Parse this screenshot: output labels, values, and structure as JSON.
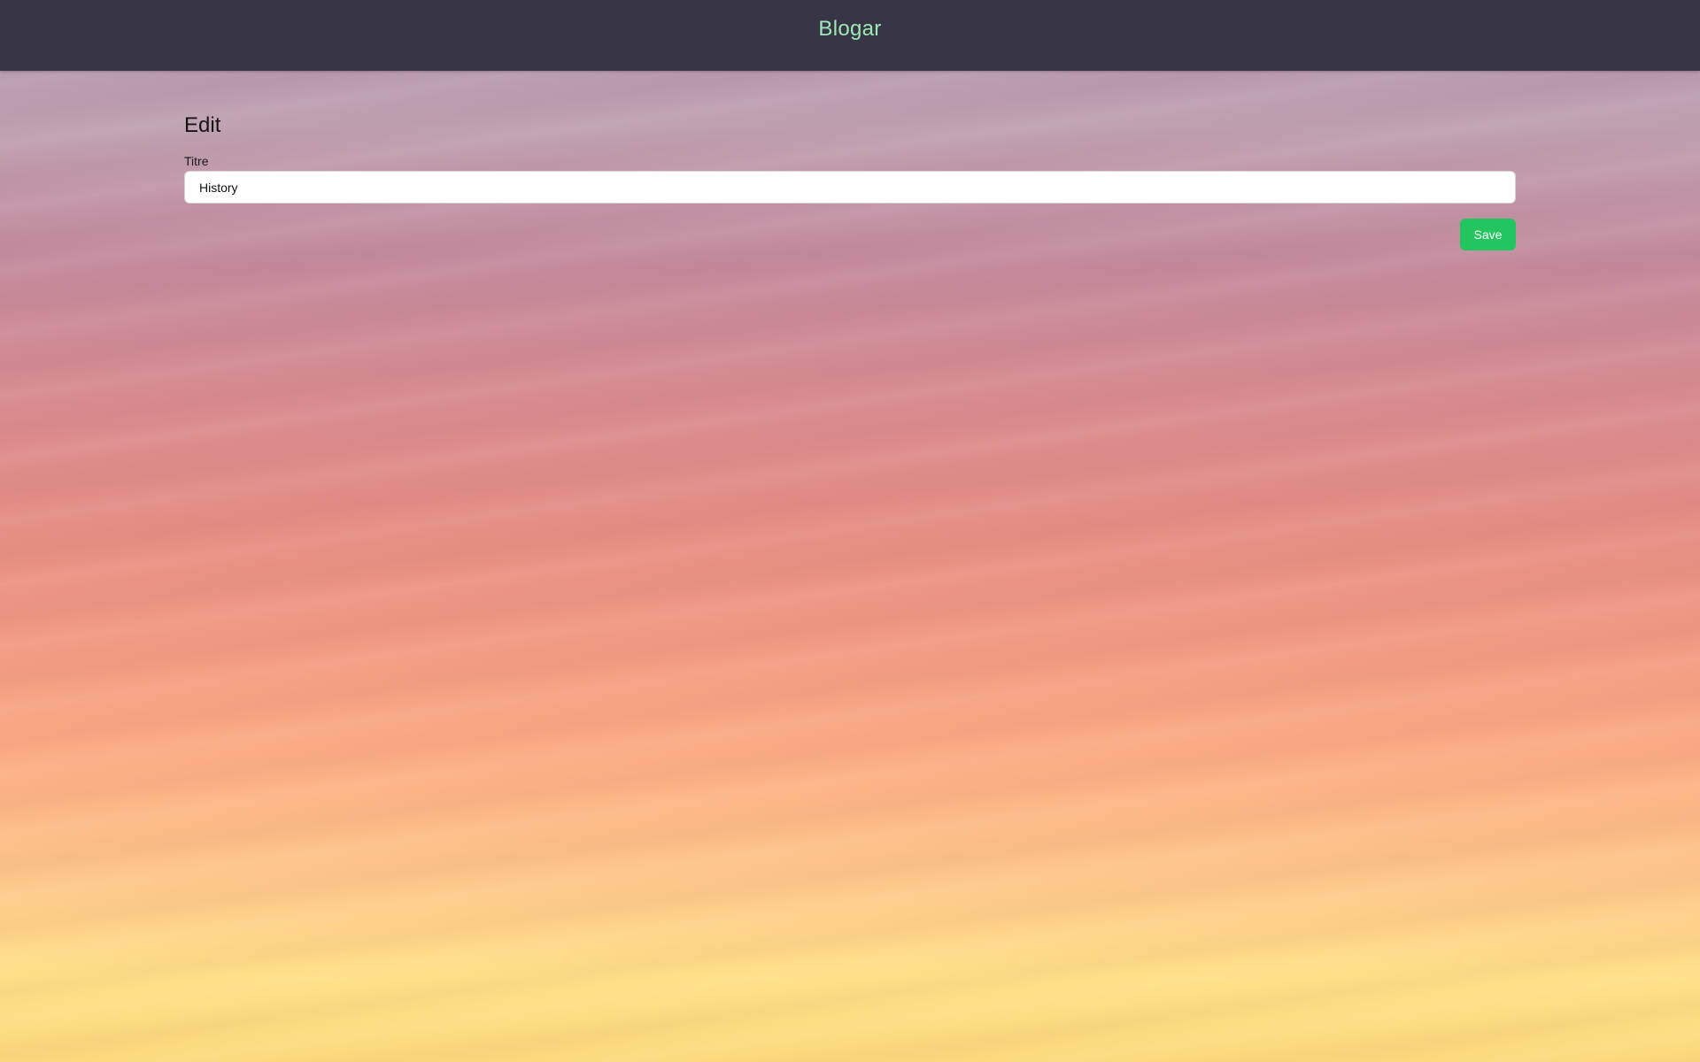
{
  "header": {
    "brand": "Blogar"
  },
  "form": {
    "title": "Edit",
    "field_label": "Titre",
    "field_value": "History",
    "save_label": "Save"
  },
  "colors": {
    "header_bg": "#363445",
    "brand_text": "#9fe8b4",
    "save_button": "#22c55e"
  }
}
